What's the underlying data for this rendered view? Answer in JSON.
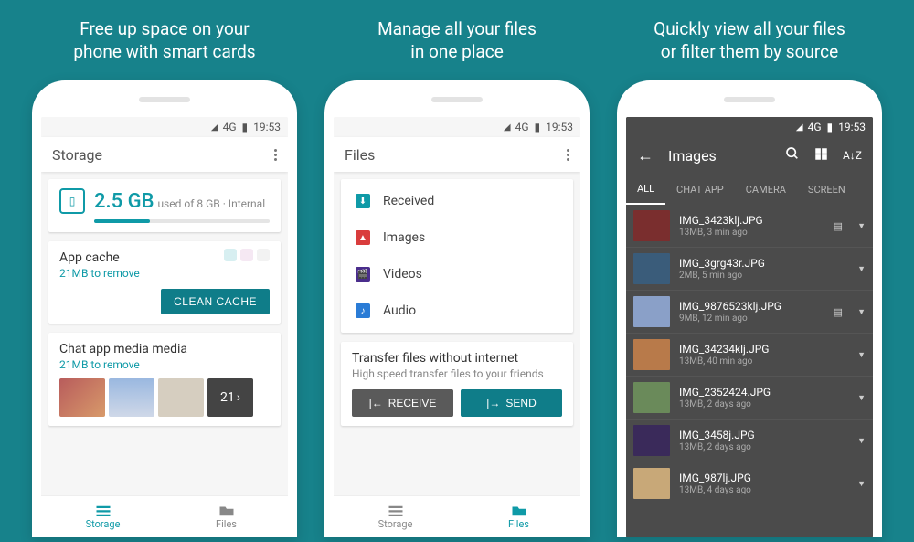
{
  "statusbar": {
    "network": "4G",
    "time": "19:53"
  },
  "screen1": {
    "heading": "Free up space on your\nphone with smart cards",
    "title": "Storage",
    "used": "2.5 GB",
    "used_label": "used of 8 GB · Internal",
    "cache_title": "App cache",
    "cache_sub": "21MB to remove",
    "clean_btn": "CLEAN CACHE",
    "chat_title": "Chat app media media",
    "chat_sub": "21MB to remove",
    "more_count": "21",
    "nav": {
      "storage": "Storage",
      "files": "Files"
    }
  },
  "screen2": {
    "heading": "Manage all your files\nin one place",
    "title": "Files",
    "categories": [
      {
        "label": "Received",
        "color": "#0f9aa7",
        "glyph": "⬇"
      },
      {
        "label": "Images",
        "color": "#d93c3c",
        "glyph": "▲"
      },
      {
        "label": "Videos",
        "color": "#4a2d8c",
        "glyph": "🎬"
      },
      {
        "label": "Audio",
        "color": "#2a7cd6",
        "glyph": "♪"
      }
    ],
    "transfer_title": "Transfer files without internet",
    "transfer_sub": "High speed transfer files to your friends",
    "receive": "RECEIVE",
    "send": "SEND",
    "nav": {
      "storage": "Storage",
      "files": "Files"
    }
  },
  "screen3": {
    "heading": "Quickly view all your files\nor filter them by source",
    "title": "Images",
    "tabs": [
      "ALL",
      "CHAT APP",
      "CAMERA",
      "SCREEN"
    ],
    "files": [
      {
        "name": "IMG_3423klj.JPG",
        "meta": "13MB, 3 min ago",
        "sd": true,
        "bg": "#7a2e2e"
      },
      {
        "name": "IMG_3grg43r.JPG",
        "meta": "2MB, 5 min ago",
        "sd": false,
        "bg": "#3a5c7a"
      },
      {
        "name": "IMG_9876523klj.JPG",
        "meta": "9MB, 12 min ago",
        "sd": true,
        "bg": "#8aa0c8"
      },
      {
        "name": "IMG_34234klj.JPG",
        "meta": "13MB, 40 min ago",
        "sd": false,
        "bg": "#b87a4a"
      },
      {
        "name": "IMG_2352424.JPG",
        "meta": "13MB, 2 days ago",
        "sd": false,
        "bg": "#6a8a5a"
      },
      {
        "name": "IMG_3458j.JPG",
        "meta": "13MB, 2 days ago",
        "sd": false,
        "bg": "#3a2a5a"
      },
      {
        "name": "IMG_987lj.JPG",
        "meta": "13MB, 4 days ago",
        "sd": false,
        "bg": "#c8a878"
      }
    ]
  }
}
